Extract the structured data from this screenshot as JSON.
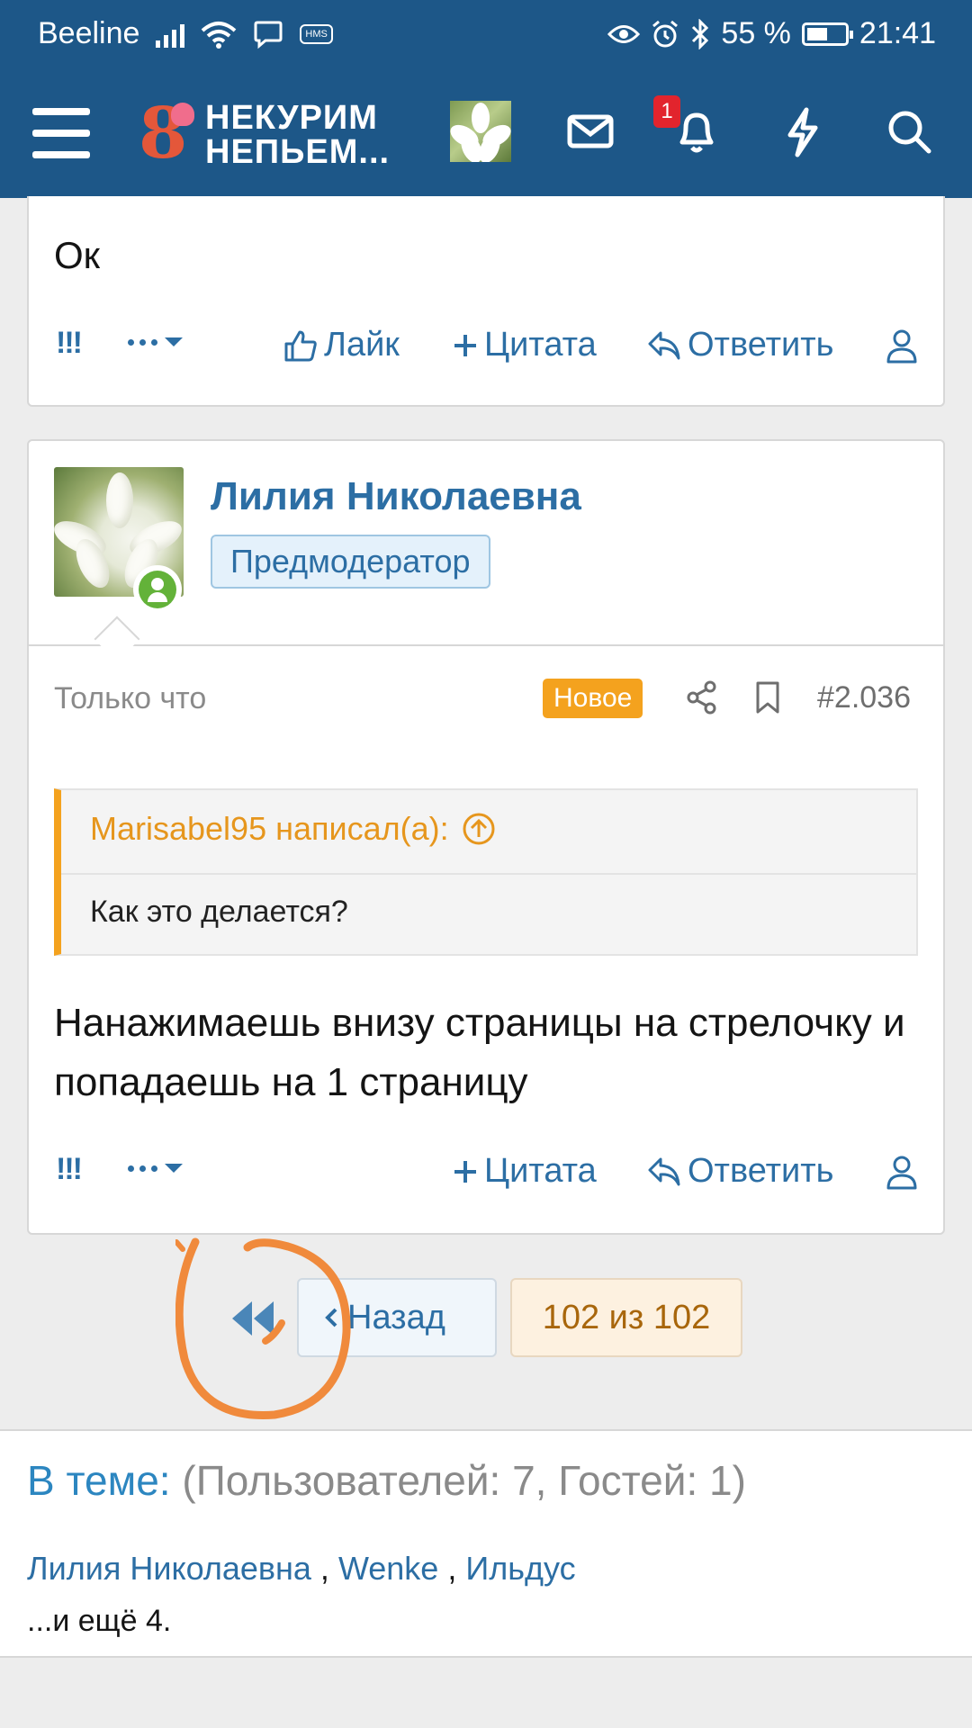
{
  "status_bar": {
    "carrier": "Beeline",
    "hms_label": "HMS",
    "battery": "55 %",
    "battery_level": 0.55,
    "time": "21:41"
  },
  "header": {
    "logo_line1": "НЕКУРИМ",
    "logo_line2": "НЕПЬЕМ...",
    "logo_numeral": "8",
    "notification_count": "1",
    "icons": [
      "menu-icon",
      "envelope-icon",
      "bell-icon",
      "lightning-icon",
      "search-icon"
    ],
    "brand_color": "#1d5788"
  },
  "post_prev": {
    "text": "Ок",
    "actions": {
      "report": "!!!",
      "like": "Лайк",
      "quote": "Цитата",
      "reply": "Ответить"
    }
  },
  "post": {
    "author": "Лилия Николаевна",
    "role": "Предмодератор",
    "time": "Только что",
    "badge_new": "Новое",
    "number": "#2.036",
    "quote": {
      "author_line": "Marisabel95 написал(а):",
      "text": "Как это делается?"
    },
    "body": "Нанажимаешь внизу страницы на стрелочку и попадаешь на 1 страницу",
    "actions": {
      "report": "!!!",
      "quote": "Цитата",
      "reply": "Ответить"
    }
  },
  "pagination": {
    "back_label": "Назад",
    "page_info": "102 из 102"
  },
  "online": {
    "title": "В теме:",
    "stats": "(Пользователей: 7, Гостей: 1)",
    "users": [
      "Лилия Николаевна",
      "Wenke",
      "Ильдус"
    ],
    "separator": " , ",
    "more": "...и ещё 4."
  },
  "colors": {
    "link": "#2c6ea4",
    "accent_orange": "#f4a21e",
    "annotation": "#f08a3c"
  }
}
